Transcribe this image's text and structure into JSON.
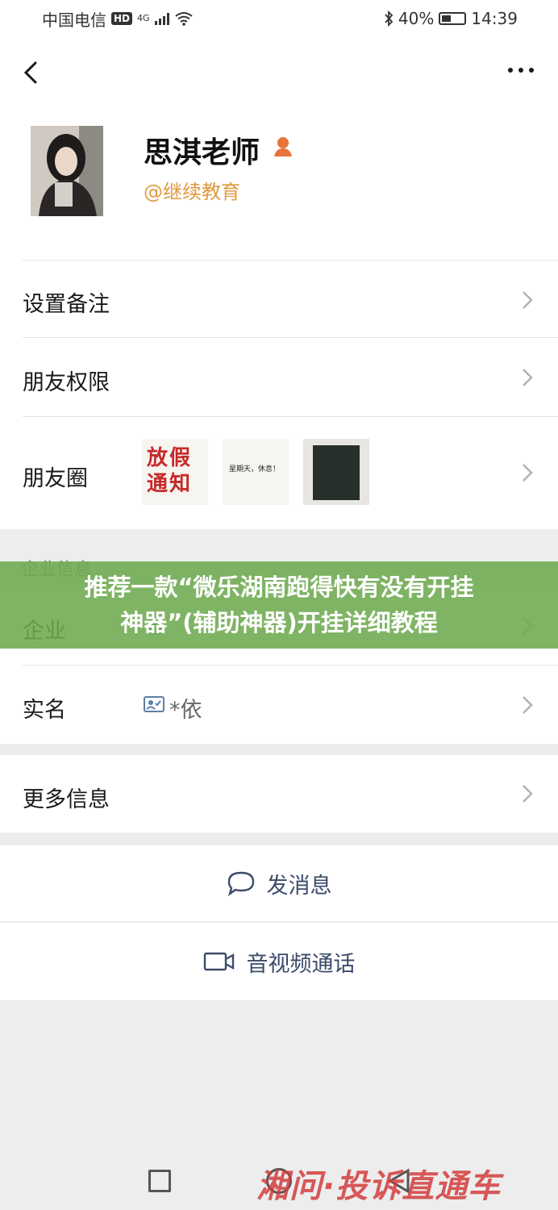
{
  "status": {
    "carrier": "中国电信",
    "hd": "HD",
    "network": "4G",
    "battery": "40%",
    "time": "14:39"
  },
  "profile": {
    "name": "思淇老师",
    "org": "@继续教育"
  },
  "rows": {
    "remark": "设置备注",
    "permission": "朋友权限",
    "moments": "朋友圈",
    "enterprise_section": "企业信息",
    "enterprise": "企业",
    "realname_label": "实名",
    "realname_value": "*依",
    "more": "更多信息"
  },
  "moments_thumbs": {
    "t1": "放假通知",
    "t2": "星期天，休息！"
  },
  "actions": {
    "message": "发消息",
    "video_call": "音视频通话"
  },
  "banner": {
    "line1": "推荐一款“微乐湖南跑得快有没有开挂",
    "line2": "神器”(辅助神器)开挂详细教程"
  },
  "watermark": "湘问·投诉直通车",
  "colors": {
    "accent_org": "#e09a3f",
    "action_text": "#3b4b6a",
    "banner_bg": "#6eaa50"
  }
}
